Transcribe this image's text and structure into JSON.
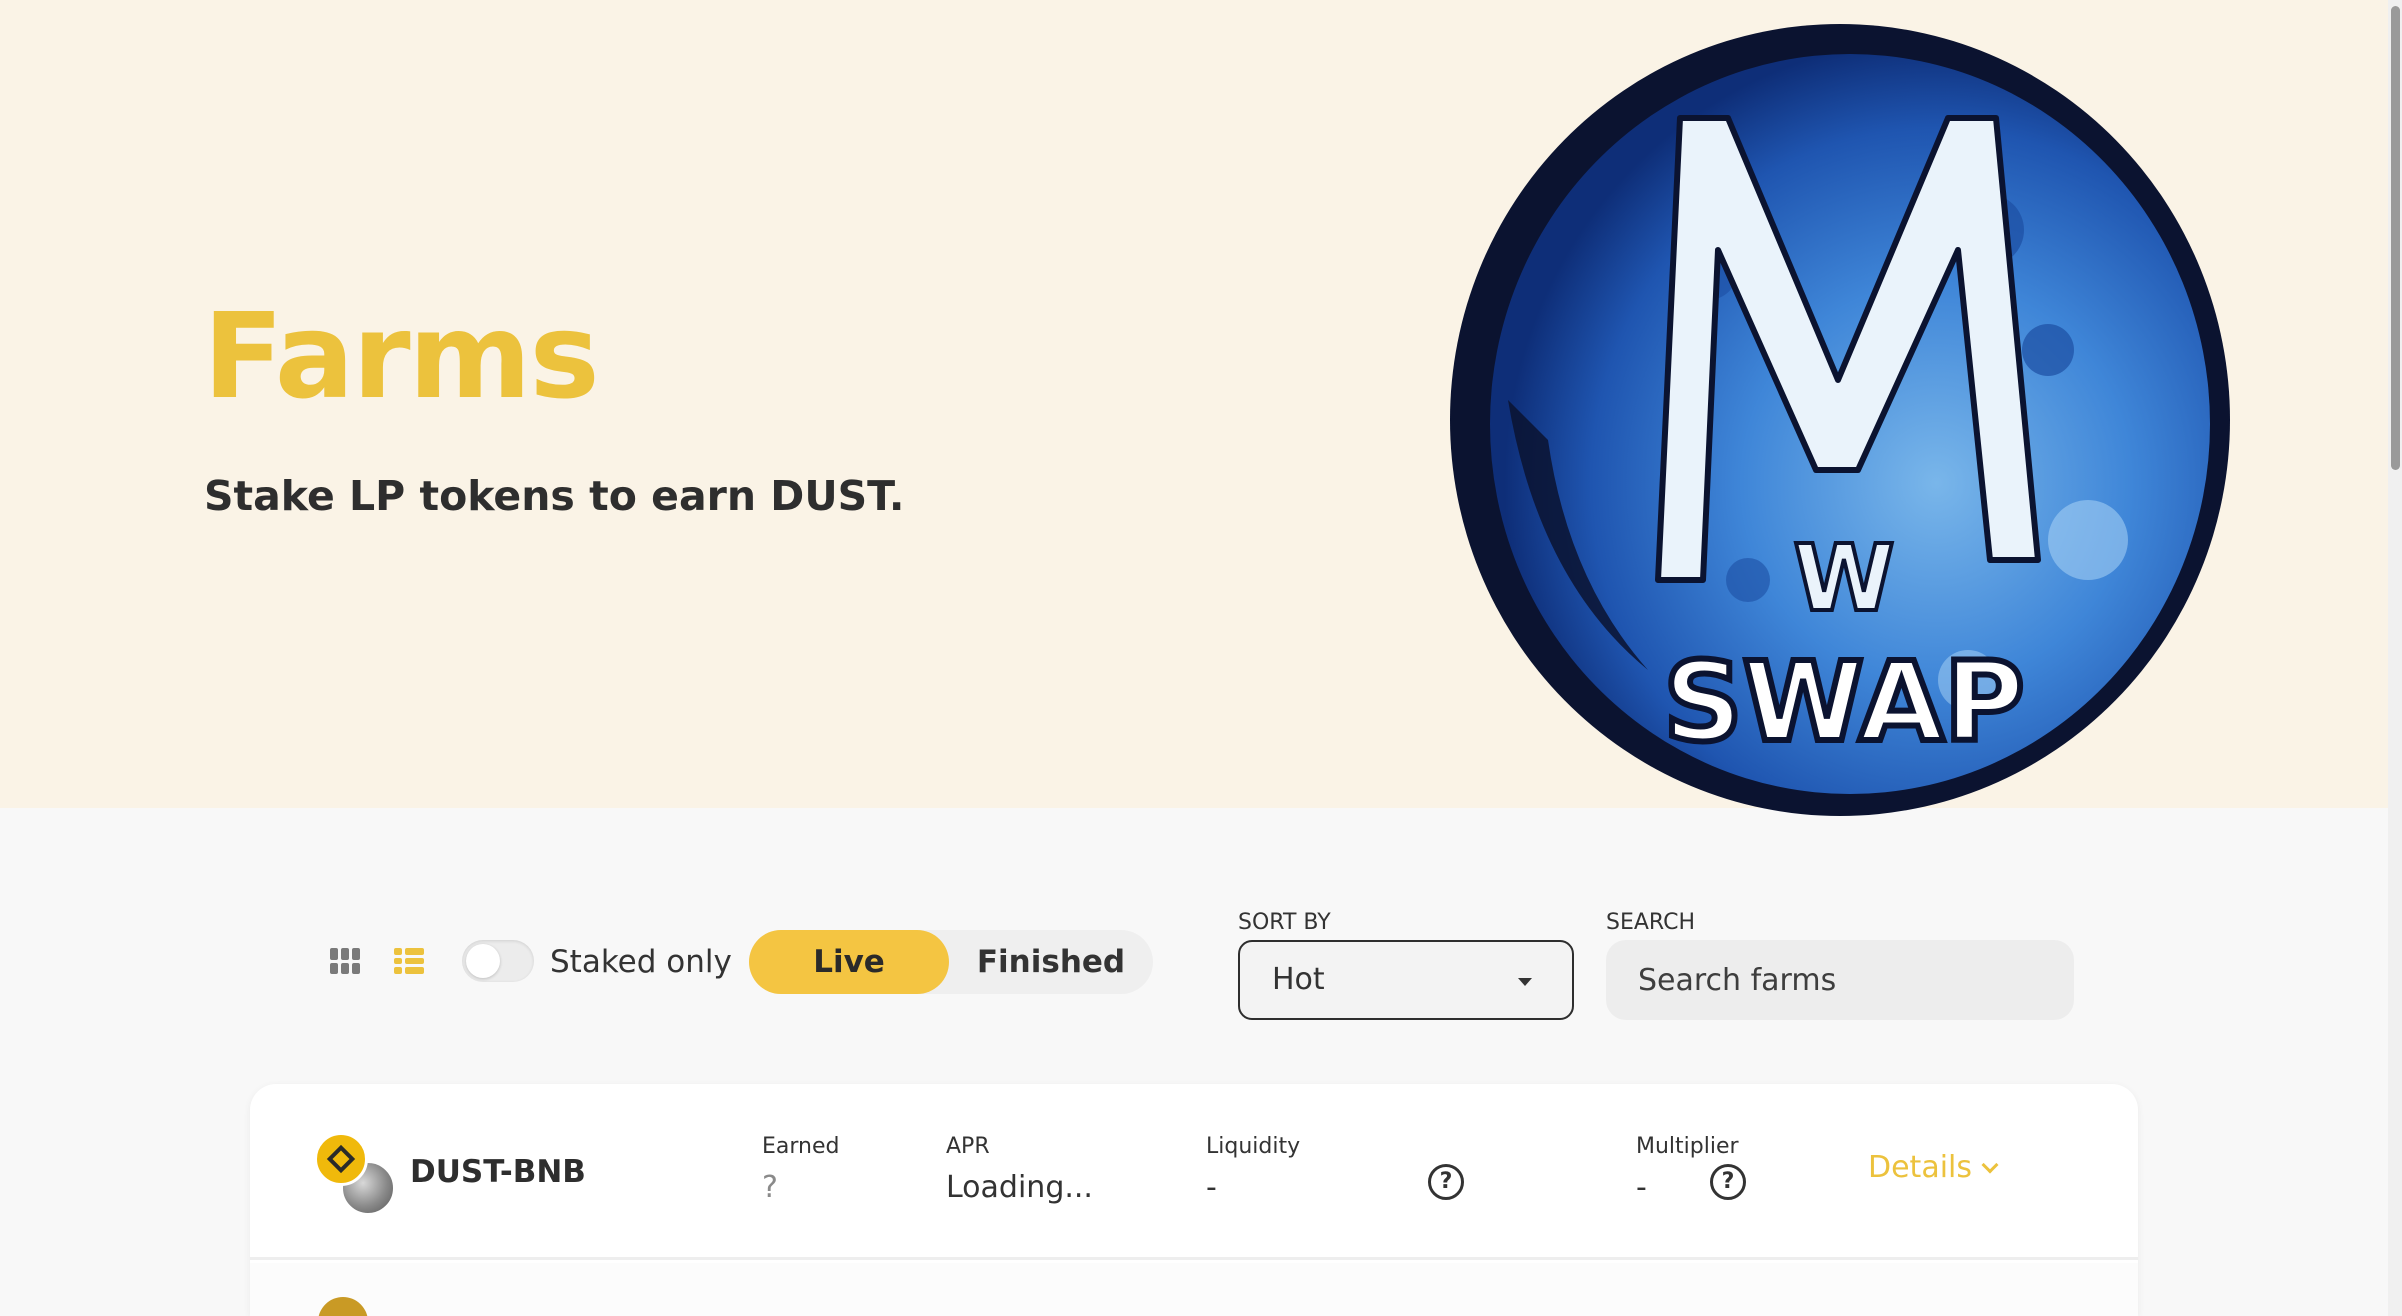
{
  "hero": {
    "title": "Farms",
    "subtitle": "Stake LP tokens to earn DUST.",
    "logo_text_main": "M",
    "logo_text_small": "W",
    "logo_text_bottom": "SWAP"
  },
  "controls": {
    "staked_only_label": "Staked only",
    "staked_only_checked": false,
    "tabs": [
      {
        "label": "Live",
        "active": true
      },
      {
        "label": "Finished",
        "active": false
      }
    ],
    "sort": {
      "label": "SORT BY",
      "value": "Hot"
    },
    "search": {
      "label": "SEARCH",
      "placeholder": "Search farms"
    }
  },
  "farms": [
    {
      "pair": "DUST-BNB",
      "earned_label": "Earned",
      "earned_value": "?",
      "apr_label": "APR",
      "apr_value": "Loading...",
      "liquidity_label": "Liquidity",
      "liquidity_value": "-",
      "multiplier_label": "Multiplier",
      "multiplier_value": "-",
      "details_label": "Details"
    }
  ],
  "colors": {
    "accent": "#ecc23d",
    "hero_background": "#faf3e6",
    "page_background": "#f8f8f8",
    "text": "#333333"
  },
  "icons": [
    "grid-view-icon",
    "list-view-icon",
    "caret-down-icon",
    "help-icon",
    "chevron-down-icon",
    "bnb-token-icon",
    "dust-token-icon"
  ]
}
